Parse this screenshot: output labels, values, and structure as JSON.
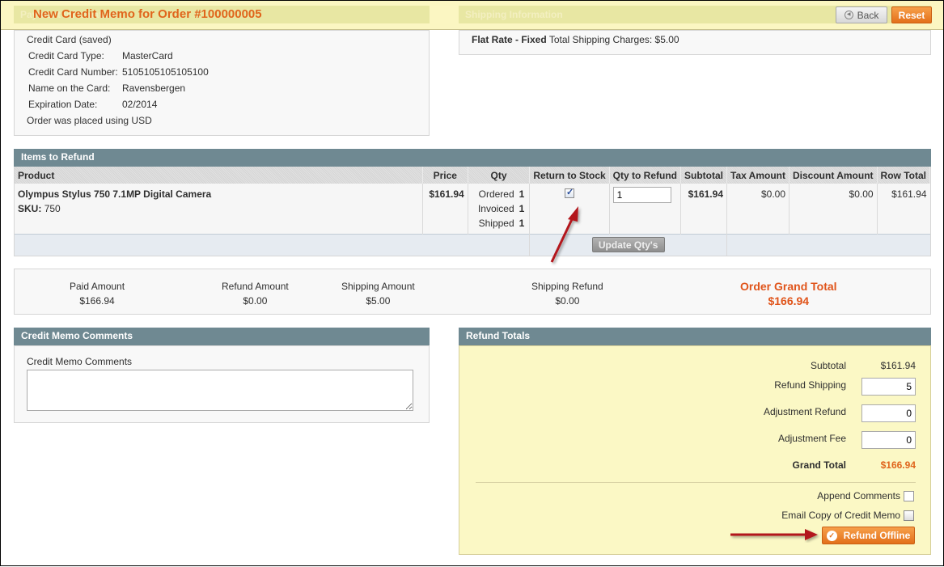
{
  "header": {
    "title": "New Credit Memo for Order #100000005",
    "ghost_left": "Payment Information",
    "ghost_right": "Shipping Information",
    "back_label": "Back",
    "reset_label": "Reset"
  },
  "payment": {
    "method": "Credit Card (saved)",
    "fields": [
      {
        "label": "Credit Card Type:",
        "value": "MasterCard"
      },
      {
        "label": "Credit Card Number:",
        "value": "5105105105105100"
      },
      {
        "label": "Name on the Card:",
        "value": "Ravensbergen"
      },
      {
        "label": "Expiration Date:",
        "value": "02/2014"
      }
    ],
    "currency_note": "Order was placed using USD"
  },
  "shipping": {
    "method_bold": "Flat Rate - Fixed",
    "charges_text": "Total Shipping Charges: $5.00"
  },
  "items": {
    "title": "Items to Refund",
    "columns": [
      "Product",
      "Price",
      "Qty",
      "Return to Stock",
      "Qty to Refund",
      "Subtotal",
      "Tax Amount",
      "Discount Amount",
      "Row Total"
    ],
    "rows": [
      {
        "product": "Olympus Stylus 750 7.1MP Digital Camera",
        "sku_label": "SKU:",
        "sku": "750",
        "price": "$161.94",
        "qty": [
          {
            "label": "Ordered",
            "value": "1"
          },
          {
            "label": "Invoiced",
            "value": "1"
          },
          {
            "label": "Shipped",
            "value": "1"
          }
        ],
        "return_to_stock": true,
        "qty_to_refund": "1",
        "subtotal": "$161.94",
        "tax": "$0.00",
        "discount": "$0.00",
        "row_total": "$161.94"
      }
    ],
    "update_label": "Update Qty's"
  },
  "summary": {
    "paid_label": "Paid Amount",
    "paid": "$166.94",
    "refund_label": "Refund Amount",
    "refund": "$0.00",
    "shipping_label": "Shipping Amount",
    "shipping": "$5.00",
    "shipping_refund_label": "Shipping Refund",
    "shipping_refund": "$0.00",
    "grand_label": "Order Grand Total",
    "grand": "$166.94"
  },
  "comments": {
    "title": "Credit Memo Comments",
    "label": "Credit Memo Comments",
    "value": ""
  },
  "totals": {
    "title": "Refund Totals",
    "subtotal_label": "Subtotal",
    "subtotal": "$161.94",
    "refund_shipping_label": "Refund Shipping",
    "refund_shipping": "5",
    "adj_refund_label": "Adjustment Refund",
    "adj_refund": "0",
    "adj_fee_label": "Adjustment Fee",
    "adj_fee": "0",
    "grand_label": "Grand Total",
    "grand": "$166.94",
    "append_label": "Append Comments",
    "email_label": "Email Copy of Credit Memo",
    "refund_offline_label": "Refund Offline"
  },
  "colors": {
    "accent": "#e0651c",
    "section_header": "#6f8992",
    "annotation_arrow": "#b3161b"
  }
}
